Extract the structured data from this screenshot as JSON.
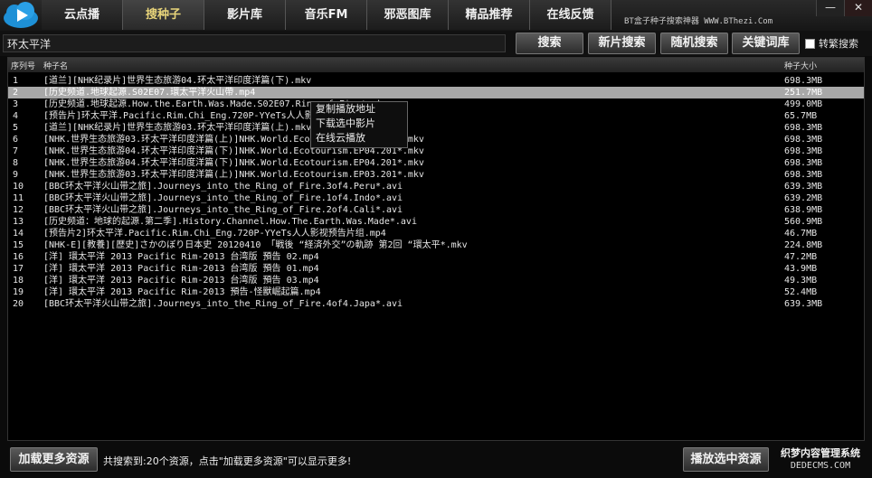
{
  "nav": {
    "tabs": [
      {
        "label": "云点播"
      },
      {
        "label": "搜种子"
      },
      {
        "label": "影片库"
      },
      {
        "label": "音乐FM"
      },
      {
        "label": "邪恶图库"
      },
      {
        "label": "精品推荐"
      },
      {
        "label": "在线反馈"
      }
    ],
    "active_tab": "搜种子",
    "brand_text": "BT盒子种子搜索神器 WWW.BThezi.Com"
  },
  "window": {
    "min_label": "—",
    "close_label": "✕"
  },
  "search": {
    "value": "环太平洋",
    "search_label": "搜索",
    "new_movies_label": "新片搜索",
    "random_label": "随机搜索",
    "keywords_label": "关键词库",
    "traditional_label": "转繁搜索"
  },
  "list": {
    "headers": {
      "index": "序列号",
      "name": "种子名",
      "size": "种子大小"
    },
    "selected_index": 1,
    "rows": [
      {
        "index": "1",
        "name": "[道兰][NHK纪录片]世界生态旅游04.环太平洋印度洋篇(下).mkv",
        "size": "698.3MB"
      },
      {
        "index": "2",
        "name": "[历史频道.地球起源.S02E07.環太平洋火山帶.mp4",
        "size": "251.7MB"
      },
      {
        "index": "3",
        "name": "[历史频道.地球起源.How.the.Earth.Was.Made.S02E07.Ring.of.Fire*.mkv",
        "size": "499.0MB"
      },
      {
        "index": "4",
        "name": "[预告片]环太平洋.Pacific.Rim.Chi_Eng.720P-YYeTs人人影视预告片组.mp4",
        "size": "65.7MB"
      },
      {
        "index": "5",
        "name": "[道兰][NHK纪录片]世界生态旅游03.环太平洋印度洋篇(上).mkv",
        "size": "698.3MB"
      },
      {
        "index": "6",
        "name": "[NHK.世界生态旅游03.环太平洋印度洋篇(上)]NHK.World.Ecotourism.EP03.201*.mkv",
        "size": "698.3MB"
      },
      {
        "index": "7",
        "name": "[NHK.世界生态旅游04.环太平洋印度洋篇(下)]NHK.World.Ecotourism.EP04.201*.mkv",
        "size": "698.3MB"
      },
      {
        "index": "8",
        "name": "[NHK.世界生态旅游04.环太平洋印度洋篇(下)]NHK.World.Ecotourism.EP04.201*.mkv",
        "size": "698.3MB"
      },
      {
        "index": "9",
        "name": "[NHK.世界生态旅游03.环太平洋印度洋篇(上)]NHK.World.Ecotourism.EP03.201*.mkv",
        "size": "698.3MB"
      },
      {
        "index": "10",
        "name": "[BBC环太平洋火山带之旅].Journeys_into_the_Ring_of_Fire.3of4.Peru*.avi",
        "size": "639.3MB"
      },
      {
        "index": "11",
        "name": "[BBC环太平洋火山带之旅].Journeys_into_the_Ring_of_Fire.1of4.Indo*.avi",
        "size": "639.2MB"
      },
      {
        "index": "12",
        "name": "[BBC环太平洋火山带之旅].Journeys_into_the_Ring_of_Fire.2of4.Cali*.avi",
        "size": "638.9MB"
      },
      {
        "index": "13",
        "name": "[历史频道：地球的起源.第二季].History.Channel.How.The.Earth.Was.Made*.avi",
        "size": "560.9MB"
      },
      {
        "index": "14",
        "name": "[预告片2]环太平洋.Pacific.Rim.Chi_Eng.720P-YYeTs人人影视预告片组.mp4",
        "size": "46.7MB"
      },
      {
        "index": "15",
        "name": "[NHK-E][教養][歴史]さかのぼり日本史 20120410 「戦後 “経済外交”の軌跡 第2回 “環太平*.mkv",
        "size": "224.8MB"
      },
      {
        "index": "16",
        "name": "[洋] 環太平洋 2013 Pacific Rim-2013 台湾版 預告 02.mp4",
        "size": "47.2MB"
      },
      {
        "index": "17",
        "name": "[洋] 環太平洋 2013 Pacific Rim-2013 台湾版 預告 01.mp4",
        "size": "43.9MB"
      },
      {
        "index": "18",
        "name": "[洋] 環太平洋 2013 Pacific Rim-2013 台湾版 預告 03.mp4",
        "size": "49.3MB"
      },
      {
        "index": "19",
        "name": "[洋] 環太平洋 2013 Pacific Rim-2013 預告-怪獸崛起篇.mp4",
        "size": "52.4MB"
      },
      {
        "index": "20",
        "name": "[BBC环太平洋火山带之旅].Journeys_into_the_Ring_of_Fire.4of4.Japa*.avi",
        "size": "639.3MB"
      }
    ]
  },
  "context_menu": {
    "items": [
      {
        "label": "复制播放地址"
      },
      {
        "label": "下载选中影片"
      },
      {
        "label": "在线云播放"
      }
    ]
  },
  "bottom": {
    "load_more_label": "加载更多资源",
    "status_text": "共搜索到:20个资源，点击\"加载更多资源\"可以显示更多!",
    "play_selected_label": "播放选中资源"
  },
  "watermark": {
    "line1": "织梦内容管理系统",
    "line2": "DEDECMS.COM"
  },
  "colors": {
    "accent": "#1e90d6",
    "active_tab_text": "#e8d47a",
    "selection": "#a8a8a8"
  }
}
